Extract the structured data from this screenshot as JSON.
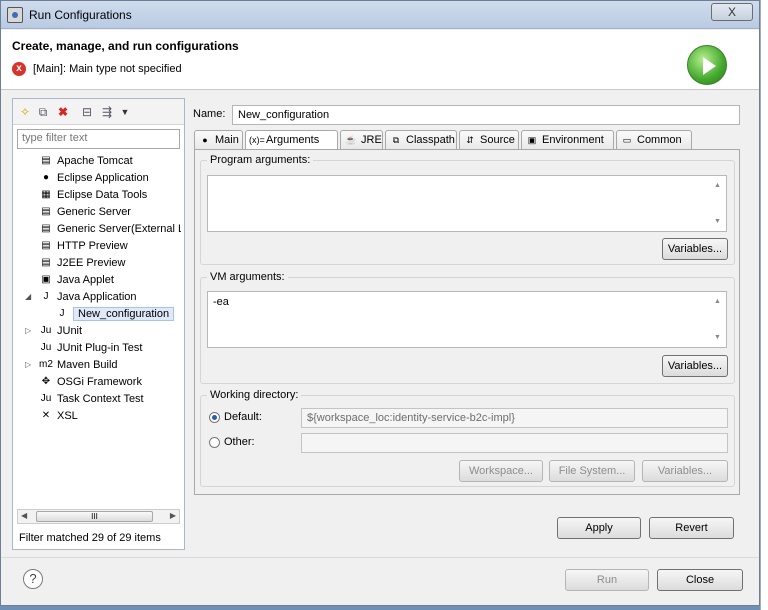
{
  "window": {
    "title": "Run Configurations",
    "close_label": "X"
  },
  "header": {
    "title": "Create, manage, and run configurations",
    "error_message": "[Main]: Main type not specified",
    "error_glyph": "x"
  },
  "left": {
    "filter_placeholder": "type filter text",
    "tree": [
      {
        "label": "Apache Tomcat",
        "icon": "server-icon",
        "glyph": "▤",
        "depth": 1,
        "expander": ""
      },
      {
        "label": "Eclipse Application",
        "icon": "eclipse-icon",
        "glyph": "●",
        "depth": 1,
        "expander": ""
      },
      {
        "label": "Eclipse Data Tools",
        "icon": "database-icon",
        "glyph": "▦",
        "depth": 1,
        "expander": ""
      },
      {
        "label": "Generic Server",
        "icon": "server-icon",
        "glyph": "▤",
        "depth": 1,
        "expander": ""
      },
      {
        "label": "Generic Server(External L",
        "icon": "server-icon",
        "glyph": "▤",
        "depth": 1,
        "expander": ""
      },
      {
        "label": "HTTP Preview",
        "icon": "server-icon",
        "glyph": "▤",
        "depth": 1,
        "expander": ""
      },
      {
        "label": "J2EE Preview",
        "icon": "server-icon",
        "glyph": "▤",
        "depth": 1,
        "expander": ""
      },
      {
        "label": "Java Applet",
        "icon": "applet-icon",
        "glyph": "▣",
        "depth": 1,
        "expander": ""
      },
      {
        "label": "Java Application",
        "icon": "java-app-icon",
        "glyph": "J",
        "depth": 1,
        "expander": "◢"
      },
      {
        "label": "New_configuration",
        "icon": "java-app-icon",
        "glyph": "J",
        "depth": 2,
        "expander": "",
        "selected": true
      },
      {
        "label": "JUnit",
        "icon": "junit-icon",
        "glyph": "Ju",
        "depth": 1,
        "expander": "▷"
      },
      {
        "label": "JUnit Plug-in Test",
        "icon": "junit-plugin-icon",
        "glyph": "Ju",
        "depth": 1,
        "expander": ""
      },
      {
        "label": "Maven Build",
        "icon": "maven-icon",
        "glyph": "m2",
        "depth": 1,
        "expander": "▷"
      },
      {
        "label": "OSGi Framework",
        "icon": "osgi-icon",
        "glyph": "✥",
        "depth": 1,
        "expander": ""
      },
      {
        "label": "Task Context Test",
        "icon": "task-icon",
        "glyph": "Ju",
        "depth": 1,
        "expander": ""
      },
      {
        "label": "XSL",
        "icon": "xsl-icon",
        "glyph": "✕",
        "depth": 1,
        "expander": ""
      }
    ],
    "scroll_thumb": "III",
    "status": "Filter matched 29 of 29 items"
  },
  "form": {
    "name_label": "Name:",
    "name_value": "New_configuration",
    "tabs": [
      {
        "label": "Main",
        "icon": "main-tab-icon",
        "glyph": "●"
      },
      {
        "label": "Arguments",
        "icon": "arguments-tab-icon",
        "glyph": "(x)="
      },
      {
        "label": "JRE",
        "icon": "jre-tab-icon",
        "glyph": "☕"
      },
      {
        "label": "Classpath",
        "icon": "classpath-tab-icon",
        "glyph": "⧉"
      },
      {
        "label": "Source",
        "icon": "source-tab-icon",
        "glyph": "⇵"
      },
      {
        "label": "Environment",
        "icon": "environment-tab-icon",
        "glyph": "▣"
      },
      {
        "label": "Common",
        "icon": "common-tab-icon",
        "glyph": "▭"
      }
    ],
    "active_tab": "Arguments",
    "program_args_label": "Program arguments:",
    "program_args_value": "",
    "vm_args_label": "VM arguments:",
    "vm_args_value": "-ea",
    "variables_label": "Variables...",
    "working_dir_label": "Working directory:",
    "default_label": "Default:",
    "default_value": "${workspace_loc:identity-service-b2c-impl}",
    "other_label": "Other:",
    "other_value": "",
    "workspace_label": "Workspace...",
    "filesystem_label": "File System...",
    "apply_label": "Apply",
    "revert_label": "Revert"
  },
  "footer": {
    "help_label": "?",
    "run_label": "Run",
    "close_label": "Close"
  }
}
